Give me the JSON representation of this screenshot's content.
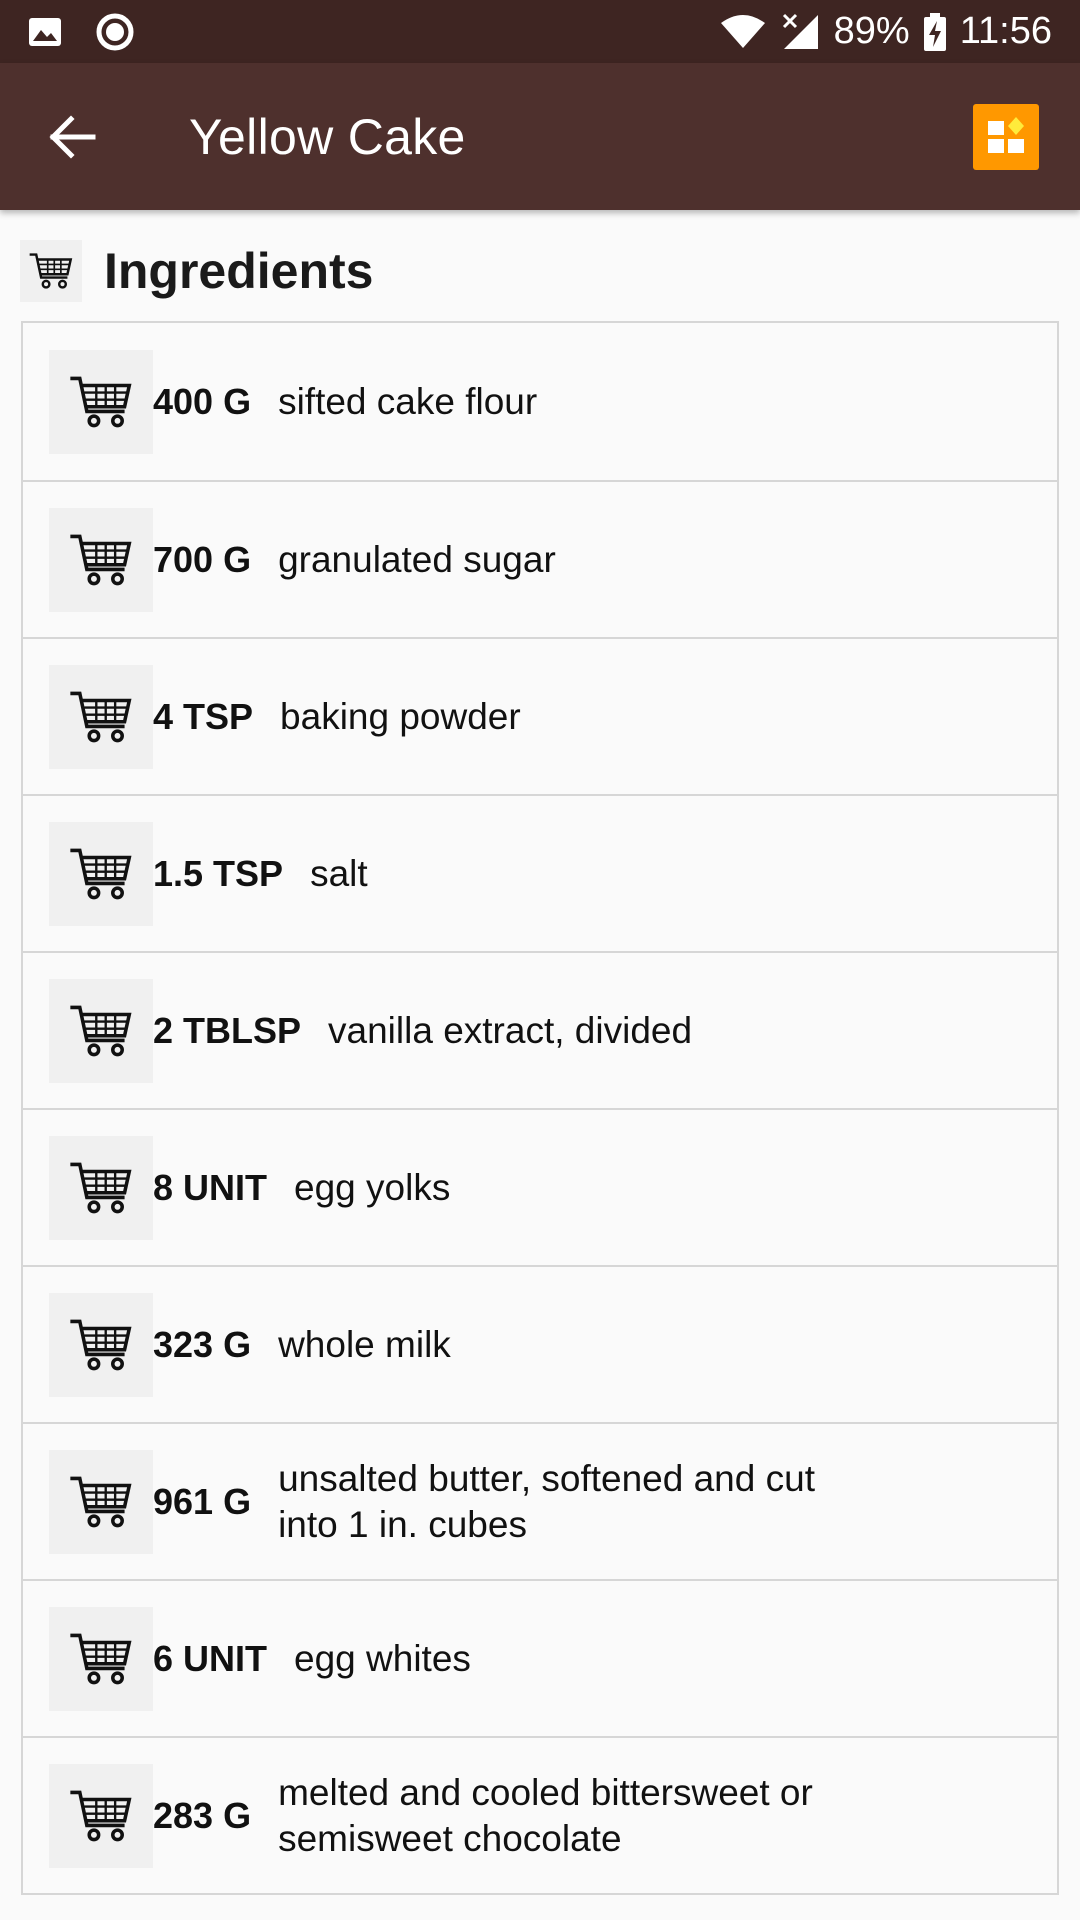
{
  "status_bar": {
    "battery": "89%",
    "time": "11:56"
  },
  "app_bar": {
    "title": "Yellow Cake"
  },
  "section": {
    "title": "Ingredients"
  },
  "ingredients": [
    {
      "qty": "400 G",
      "name": "sifted cake flour"
    },
    {
      "qty": "700 G",
      "name": "granulated sugar"
    },
    {
      "qty": "4 TSP",
      "name": "baking powder"
    },
    {
      "qty": "1.5 TSP",
      "name": "salt"
    },
    {
      "qty": "2 TBLSP",
      "name": "vanilla extract, divided"
    },
    {
      "qty": "8 UNIT",
      "name": "egg yolks"
    },
    {
      "qty": "323 G",
      "name": "whole milk"
    },
    {
      "qty": "961 G",
      "name": "unsalted butter, softened and cut into 1 in. cubes"
    },
    {
      "qty": "6 UNIT",
      "name": "egg whites"
    },
    {
      "qty": "283 G",
      "name": "melted and cooled bittersweet or semisweet chocolate"
    }
  ],
  "icons": {
    "back": "arrow-back-icon",
    "menu": "grid-view-icon",
    "cart": "shopping-cart-icon"
  },
  "colors": {
    "status_bar": "#3e2522",
    "app_bar": "#4e302d",
    "accent": "#ff9800"
  }
}
